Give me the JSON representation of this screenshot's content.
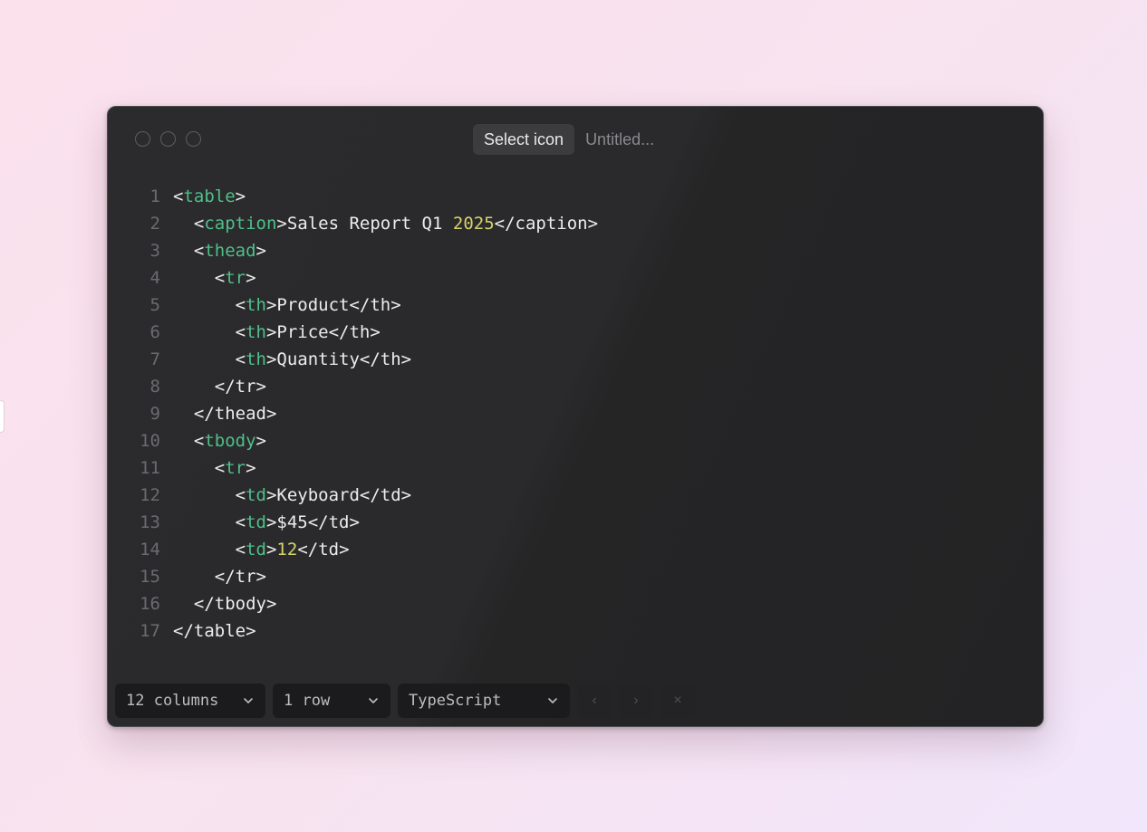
{
  "window": {
    "select_icon_label": "Select icon",
    "title_placeholder": "Untitled..."
  },
  "code_lines": [
    [
      {
        "t": "<",
        "c": ""
      },
      {
        "t": "table",
        "c": "tag"
      },
      {
        "t": ">",
        "c": ""
      }
    ],
    [
      {
        "t": "  <",
        "c": ""
      },
      {
        "t": "caption",
        "c": "tag"
      },
      {
        "t": ">Sales Report Q1 ",
        "c": ""
      },
      {
        "t": "2025",
        "c": "num"
      },
      {
        "t": "</caption>",
        "c": ""
      }
    ],
    [
      {
        "t": "  <",
        "c": ""
      },
      {
        "t": "thead",
        "c": "tag"
      },
      {
        "t": ">",
        "c": ""
      }
    ],
    [
      {
        "t": "    <",
        "c": ""
      },
      {
        "t": "tr",
        "c": "tag"
      },
      {
        "t": ">",
        "c": ""
      }
    ],
    [
      {
        "t": "      <",
        "c": ""
      },
      {
        "t": "th",
        "c": "tag"
      },
      {
        "t": ">Product</th>",
        "c": ""
      }
    ],
    [
      {
        "t": "      <",
        "c": ""
      },
      {
        "t": "th",
        "c": "tag"
      },
      {
        "t": ">Price</th>",
        "c": ""
      }
    ],
    [
      {
        "t": "      <",
        "c": ""
      },
      {
        "t": "th",
        "c": "tag"
      },
      {
        "t": ">Quantity</th>",
        "c": ""
      }
    ],
    [
      {
        "t": "    </tr>",
        "c": ""
      }
    ],
    [
      {
        "t": "  </thead>",
        "c": ""
      }
    ],
    [
      {
        "t": "  <",
        "c": ""
      },
      {
        "t": "tbody",
        "c": "tag"
      },
      {
        "t": ">",
        "c": ""
      }
    ],
    [
      {
        "t": "    <",
        "c": ""
      },
      {
        "t": "tr",
        "c": "tag"
      },
      {
        "t": ">",
        "c": ""
      }
    ],
    [
      {
        "t": "      <",
        "c": ""
      },
      {
        "t": "td",
        "c": "tag"
      },
      {
        "t": ">Keyboard</td>",
        "c": ""
      }
    ],
    [
      {
        "t": "      <",
        "c": ""
      },
      {
        "t": "td",
        "c": "tag"
      },
      {
        "t": ">$45</td>",
        "c": ""
      }
    ],
    [
      {
        "t": "      <",
        "c": ""
      },
      {
        "t": "td",
        "c": "tag"
      },
      {
        "t": ">",
        "c": ""
      },
      {
        "t": "12",
        "c": "num"
      },
      {
        "t": "</td>",
        "c": ""
      }
    ],
    [
      {
        "t": "    </tr>",
        "c": ""
      }
    ],
    [
      {
        "t": "  </tbody>",
        "c": ""
      }
    ],
    [
      {
        "t": "</table>",
        "c": ""
      }
    ]
  ],
  "footer": {
    "columns_label": "12 columns",
    "rows_label": "1 row",
    "language_label": "TypeScript",
    "prev_glyph": "‹",
    "next_glyph": "›",
    "close_glyph": "×"
  },
  "icons": {
    "chevron": "chevron-down-icon",
    "prev": "chevron-left-icon",
    "next": "chevron-right-icon",
    "close": "close-icon"
  },
  "colors": {
    "tag": "#4fbf8a",
    "number": "#d6d36a",
    "text": "#ececec",
    "line_number": "#6b6b70"
  }
}
